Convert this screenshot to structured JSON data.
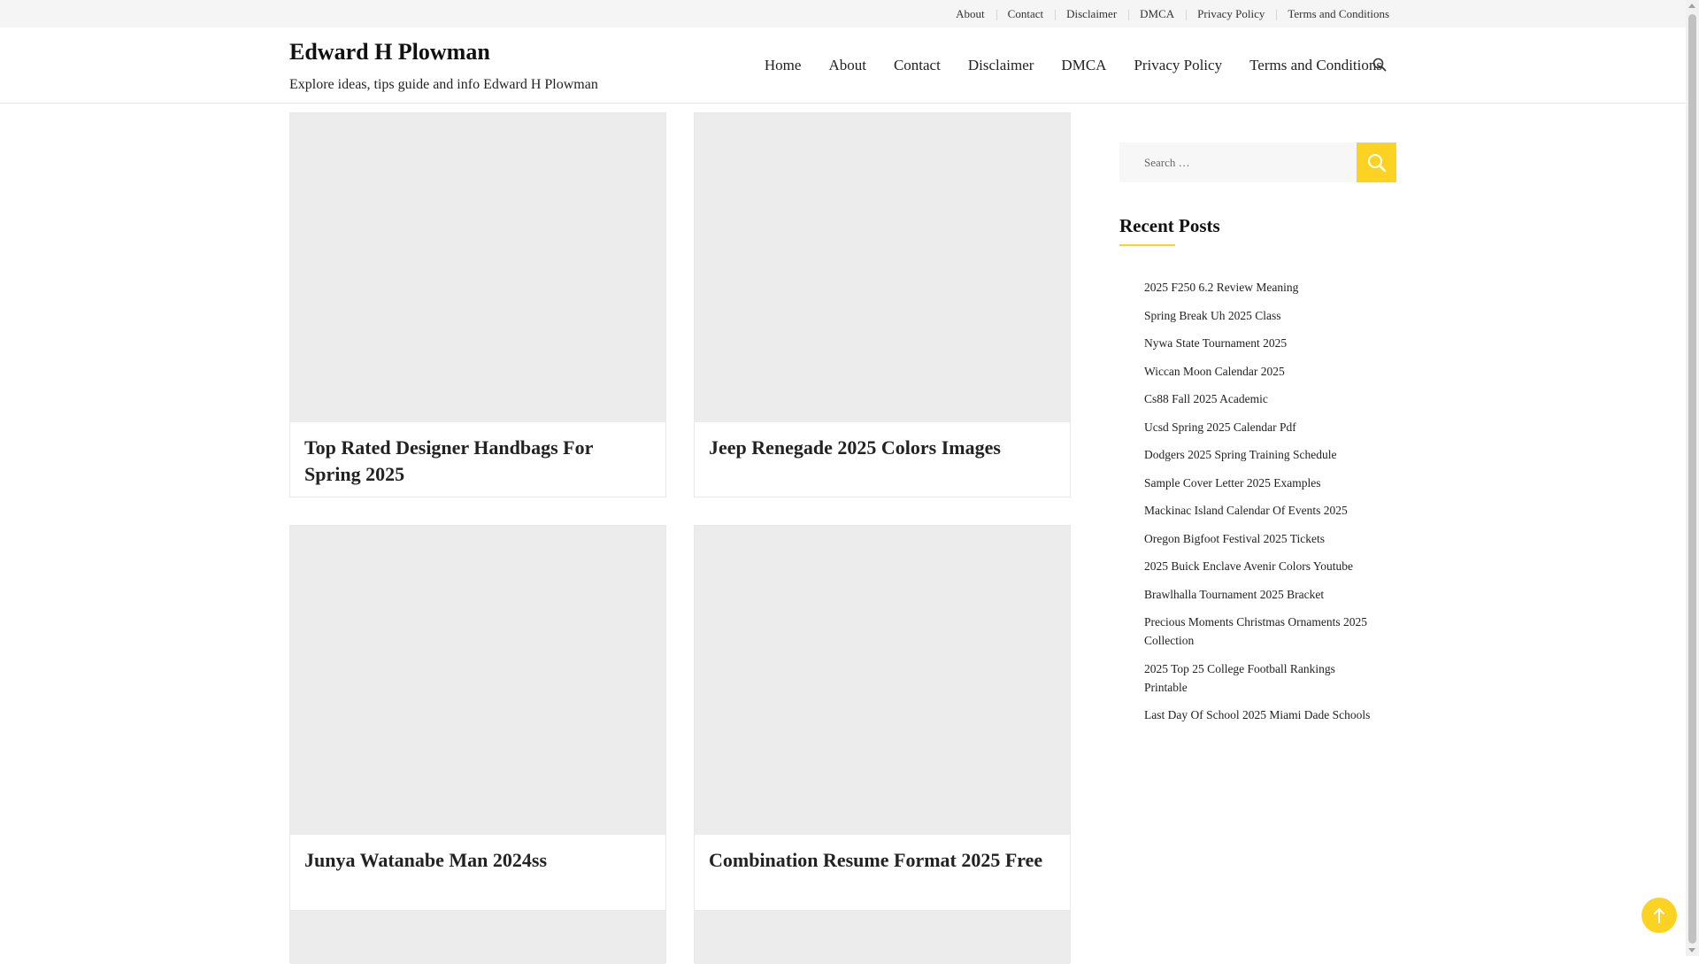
{
  "topbar": {
    "links": [
      "About",
      "Contact",
      "Disclaimer",
      "DMCA",
      "Privacy Policy",
      "Terms and Conditions"
    ]
  },
  "header": {
    "site_title": "Edward H Plowman",
    "site_description": "Explore ideas, tips guide and info Edward H Plowman",
    "nav": [
      "Home",
      "About",
      "Contact",
      "Disclaimer",
      "DMCA",
      "Privacy Policy",
      "Terms and Conditions"
    ],
    "search_icon": "search-icon"
  },
  "posts": [
    {
      "title": "Top Rated Designer Handbags For Spring 2025"
    },
    {
      "title": "Jeep Renegade 2025 Colors Images"
    },
    {
      "title": "Junya Watanabe Man 2024ss"
    },
    {
      "title": "Combination Resume Format 2025 Free"
    }
  ],
  "sidebar": {
    "search_placeholder": "Search …",
    "recent_posts_title": "Recent Posts",
    "recent_posts": [
      "2025 F250 6.2 Review Meaning",
      "Spring Break Uh 2025 Class",
      "Nywa State Tournament 2025",
      "Wiccan Moon Calendar 2025",
      "Cs88 Fall 2025 Academic",
      "Ucsd Spring 2025 Calendar Pdf",
      "Dodgers 2025 Spring Training Schedule",
      "Sample Cover Letter 2025 Examples",
      "Mackinac Island Calendar Of Events 2025",
      "Oregon Bigfoot Festival 2025 Tickets",
      "2025 Buick Enclave Avenir Colors Youtube",
      "Brawlhalla Tournament 2025 Bracket",
      "Precious Moments Christmas Ornaments 2025 Collection",
      "2025 Top 25 College Football Rankings Printable",
      "Last Day Of School 2025 Miami Dade Schools"
    ]
  },
  "colors": {
    "accent": "#fdd323",
    "thumb_placeholder": "#ececec",
    "topbar_bg": "#f5f5f5"
  },
  "back_to_top_icon": "arrow-up-icon"
}
